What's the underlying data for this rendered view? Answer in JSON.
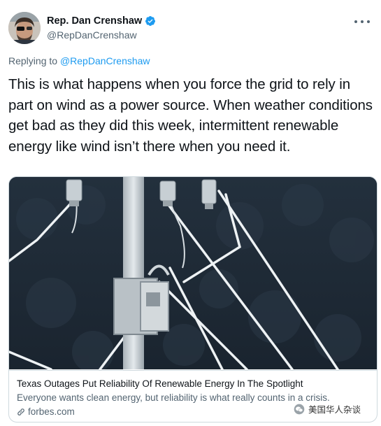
{
  "author": {
    "display_name": "Rep. Dan Crenshaw",
    "handle": "@RepDanCrenshaw",
    "verified": true,
    "avatar_icon": "profile-photo-avatar"
  },
  "reply": {
    "prefix": "Replying to ",
    "to": "@RepDanCrenshaw"
  },
  "tweet": {
    "text": "This is what happens when you force the grid to rely in part on wind as a power source. When weather conditions get bad as they did this week, intermittent renewable energy like wind isn’t there when you need it."
  },
  "card": {
    "image_icon": "frozen-power-lines-photo",
    "title": "Texas Outages Put Reliability Of Renewable Energy In The Spotlight",
    "description": "Everyone wants clean energy, but reliability is what really counts in a crisis.",
    "domain": "forbes.com"
  },
  "watermark": {
    "text": "美国华人杂谈"
  },
  "colors": {
    "accent": "#1d9bf0",
    "text_primary": "#0f1419",
    "text_secondary": "#536471",
    "border": "#cfd9de"
  }
}
